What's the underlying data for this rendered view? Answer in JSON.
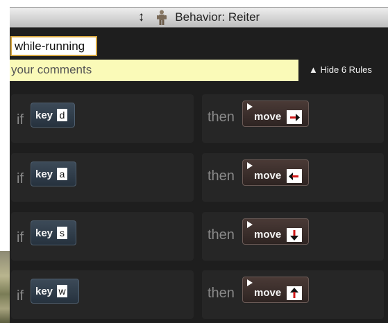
{
  "window": {
    "title": "Behavior: Reiter",
    "resize_icon": "resize-vertical-icon",
    "robot_icon": "robot-icon"
  },
  "behavior": {
    "name": "while-running",
    "comments_placeholder": "your comments",
    "hide_rules_label": "▲ Hide 6 Rules"
  },
  "rules": [
    {
      "if_label": "if",
      "sensor_label": "key",
      "key": "d",
      "then_label": "then",
      "action_label": "move",
      "direction": "right"
    },
    {
      "if_label": "if",
      "sensor_label": "key",
      "key": "a",
      "then_label": "then",
      "action_label": "move",
      "direction": "left"
    },
    {
      "if_label": "if",
      "sensor_label": "key",
      "key": "s",
      "then_label": "then",
      "action_label": "move",
      "direction": "down"
    },
    {
      "if_label": "if",
      "sensor_label": "key",
      "key": "w",
      "then_label": "then",
      "action_label": "move",
      "direction": "up"
    }
  ],
  "colors": {
    "arrow_red": "#d01818",
    "arrow_black": "#111111",
    "name_border": "#d6a640",
    "comments_bg": "#fafab8"
  }
}
